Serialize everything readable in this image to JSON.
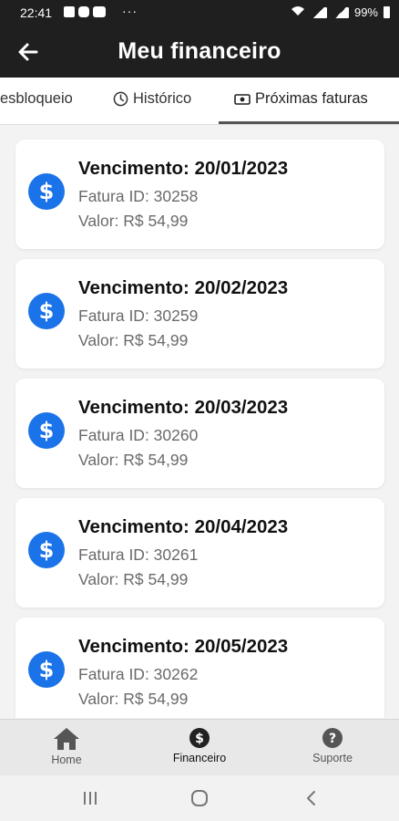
{
  "status_bar": {
    "time": "22:41",
    "more": "···",
    "battery": "99%",
    "icons": [
      "image-icon",
      "instagram-icon",
      "youtube-icon",
      "wifi-icon",
      "signal-icon",
      "battery-icon"
    ]
  },
  "header": {
    "title": "Meu financeiro",
    "back_icon": "arrow-left-icon"
  },
  "tabs": [
    {
      "label": "esbloqueio",
      "icon": ""
    },
    {
      "label": "Histórico",
      "icon": "clock-icon"
    },
    {
      "label": "Próximas faturas",
      "icon": "cash-icon",
      "active": true
    }
  ],
  "invoices": [
    {
      "due": "Vencimento: 20/01/2023",
      "id": "Fatura ID: 30258",
      "value": "Valor: R$ 54,99"
    },
    {
      "due": "Vencimento: 20/02/2023",
      "id": "Fatura ID: 30259",
      "value": "Valor: R$ 54,99"
    },
    {
      "due": "Vencimento: 20/03/2023",
      "id": "Fatura ID: 30260",
      "value": "Valor: R$ 54,99"
    },
    {
      "due": "Vencimento: 20/04/2023",
      "id": "Fatura ID: 30261",
      "value": "Valor: R$ 54,99"
    },
    {
      "due": "Vencimento: 20/05/2023",
      "id": "Fatura ID: 30262",
      "value": "Valor: R$ 54,99"
    }
  ],
  "bottom_nav": [
    {
      "label": "Home",
      "icon": "home-icon"
    },
    {
      "label": "Financeiro",
      "icon": "dollar-circle-icon",
      "active": true
    },
    {
      "label": "Suporte",
      "icon": "help-circle-icon"
    }
  ],
  "colors": {
    "accent": "#1a73e8",
    "header_bg": "#1f1f1f"
  }
}
